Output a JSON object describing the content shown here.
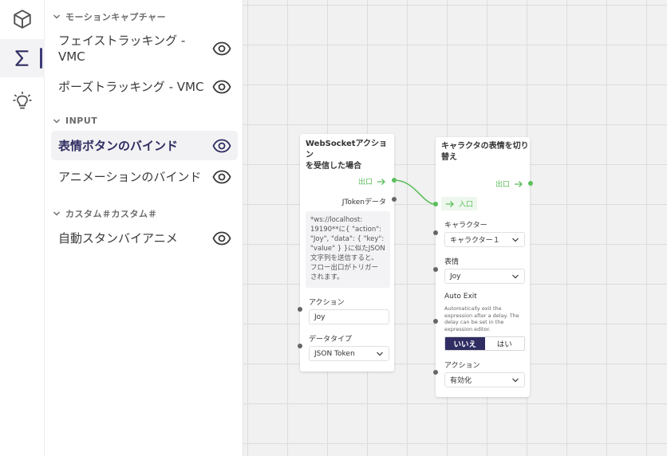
{
  "rail": {
    "items": [
      {
        "icon": "cube-icon"
      },
      {
        "icon": "sigma-icon",
        "active": true
      },
      {
        "icon": "lightbulb-icon"
      }
    ]
  },
  "sidebar": {
    "categories": [
      {
        "label": "モーションキャプチャー"
      },
      {
        "label": "INPUT"
      },
      {
        "label": "カスタム＃カスタム＃"
      }
    ],
    "items": [
      {
        "label": "フェイストラッキング - VMC",
        "line1": "フェイストラッキング -",
        "line2": "VMC"
      },
      {
        "label": "ポーズトラッキング - VMC"
      },
      {
        "label": "表情ボタンのバインド",
        "selected": true
      },
      {
        "label": "アニメーションのバインド"
      },
      {
        "label": "自動スタンバイアニメ"
      }
    ]
  },
  "colors": {
    "accent": "#2f2d62",
    "flow": "#5bbf5b"
  },
  "node1": {
    "title_line1": "WebSocketアクション",
    "title_line2": "を受信した場合",
    "out_label": "出口",
    "token_label": "JTokenデータ",
    "desc_lines": [
      "*ws://localhost:",
      "19190**に{ \"action\":",
      "\"Joy\", \"data\": { \"key\":",
      "\"value\" } }に似たJSON",
      "文字列を送信すると、",
      "フロー出口がトリガー",
      "されます。"
    ],
    "action_label": "アクション",
    "action_value": "Joy",
    "datatype_label": "データタイプ",
    "datatype_value": "JSON Token"
  },
  "node2": {
    "title_line1": "キャラクタの表情を切り",
    "title_line2": "替え",
    "out_label": "出口",
    "in_label": "入口",
    "character_label": "キャラクター",
    "character_value": "キャラクター１",
    "expression_label": "表情",
    "expression_value": "Joy",
    "auto_exit_label": "Auto Exit",
    "auto_exit_desc": [
      "Automatically exit the",
      "expression after a delay. The",
      "delay can be set in the",
      "expression editor."
    ],
    "toggle_no": "いいえ",
    "toggle_yes": "はい",
    "action_label": "アクション",
    "action_value": "有効化"
  }
}
